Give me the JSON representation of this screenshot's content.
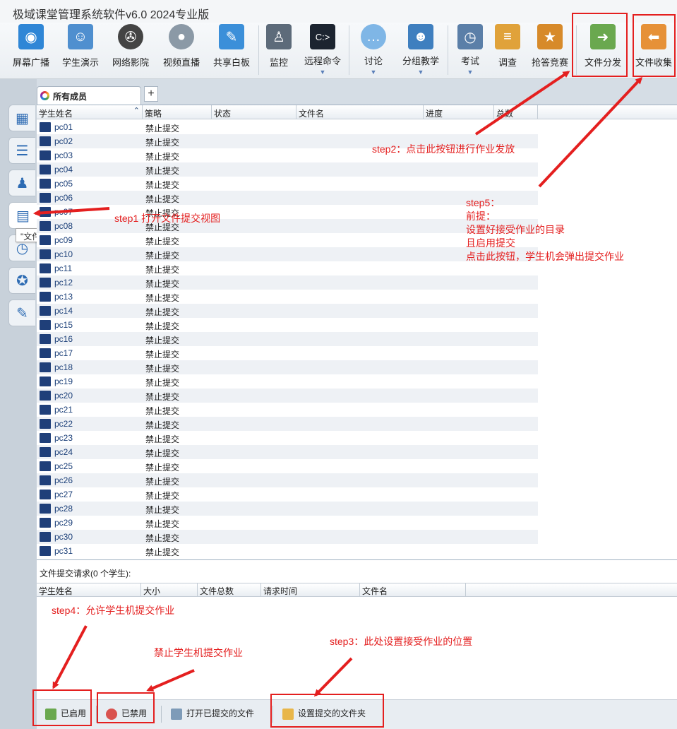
{
  "app": {
    "title": "极域课堂管理系统软件v6.0 2024专业版"
  },
  "toolbar": {
    "items": [
      {
        "label": "屏幕广播",
        "icon": "broadcast-screen-icon"
      },
      {
        "label": "学生演示",
        "icon": "student-demo-icon"
      },
      {
        "label": "网络影院",
        "icon": "film-reel-icon"
      },
      {
        "label": "视频直播",
        "icon": "webcam-icon"
      },
      {
        "label": "共享白板",
        "icon": "whiteboard-icon"
      },
      {
        "label": "监控",
        "icon": "monitor-person-icon"
      },
      {
        "label": "远程命令",
        "icon": "command-prompt-icon"
      },
      {
        "label": "讨论",
        "icon": "chat-bubbles-icon"
      },
      {
        "label": "分组教学",
        "icon": "group-people-icon"
      },
      {
        "label": "考试",
        "icon": "exam-clock-icon"
      },
      {
        "label": "调查",
        "icon": "survey-bars-icon"
      },
      {
        "label": "抢答竞赛",
        "icon": "quiz-star-icon"
      },
      {
        "label": "文件分发",
        "icon": "file-send-icon"
      },
      {
        "label": "文件收集",
        "icon": "file-collect-icon"
      }
    ]
  },
  "sidebar": {
    "tooltip": "\"文件提交\"视图"
  },
  "tabs": {
    "active": "所有成员"
  },
  "grid": {
    "columns": [
      "学生姓名",
      "策略",
      "状态",
      "文件名",
      "进度",
      "总数"
    ],
    "policy_text": "禁止提交",
    "rows": [
      "pc01",
      "pc02",
      "pc03",
      "pc04",
      "pc05",
      "pc06",
      "pc07",
      "pc08",
      "pc09",
      "pc10",
      "pc11",
      "pc12",
      "pc13",
      "pc14",
      "pc15",
      "pc16",
      "pc17",
      "pc18",
      "pc19",
      "pc20",
      "pc21",
      "pc22",
      "pc23",
      "pc24",
      "pc25",
      "pc26",
      "pc27",
      "pc28",
      "pc29",
      "pc30",
      "pc31"
    ]
  },
  "requests": {
    "caption": "文件提交请求(0 个学生):",
    "columns": [
      "学生姓名",
      "大小",
      "文件总数",
      "请求时间",
      "文件名"
    ]
  },
  "bottom": {
    "enabled": "已启用",
    "disabled": "已禁用",
    "open_submitted": "打开已提交的文件",
    "set_folder": "设置提交的文件夹"
  },
  "annotations": {
    "step1": "step1 打开文件提交视图",
    "step2": "step2：点击此按钮进行作业发放",
    "step3": "step3：此处设置接受作业的位置",
    "step4": "step4：允许学生机提交作业",
    "step4b": "禁止学生机提交作业",
    "step5_lines": [
      "step5：",
      "前提：",
      "设置好接受作业的目录",
      "且启用提交",
      "点击此按钮，学生机会弹出提交作业"
    ]
  },
  "colors": {
    "annotation": "#e41f1f",
    "row_name": "#1b3f78",
    "accent": "#2d6bb3"
  }
}
